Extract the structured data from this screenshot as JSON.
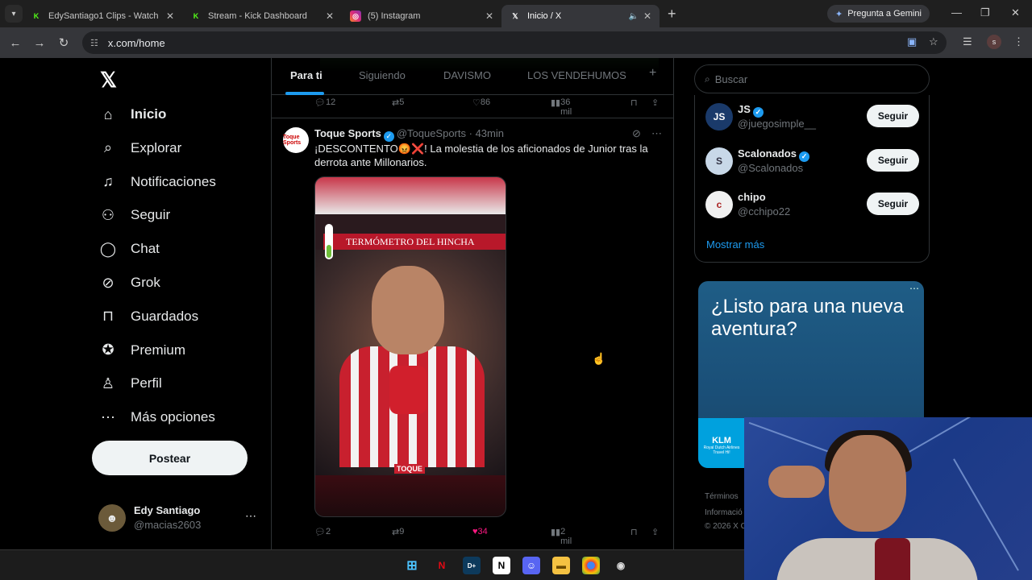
{
  "browser": {
    "tabs": [
      {
        "title": "EdySantiago1 Clips - Watch Live",
        "favicon": "kick-icon"
      },
      {
        "title": "Stream - Kick Dashboard",
        "favicon": "kick-icon"
      },
      {
        "title": "(5) Instagram",
        "favicon": "instagram-icon"
      },
      {
        "title": "Inicio / X",
        "favicon": "x-icon",
        "active": true
      }
    ],
    "gemini_label": "Pregunta a Gemini",
    "url": "x.com/home",
    "profile_initial": "s"
  },
  "sidebar": {
    "items": [
      {
        "label": "Inicio",
        "icon": "home-icon",
        "glyph": "⌂"
      },
      {
        "label": "Explorar",
        "icon": "search-icon",
        "glyph": "⌕"
      },
      {
        "label": "Notificaciones",
        "icon": "bell-icon",
        "glyph": "♫"
      },
      {
        "label": "Seguir",
        "icon": "follow-icon",
        "glyph": "⚇"
      },
      {
        "label": "Chat",
        "icon": "chat-icon",
        "glyph": "◯"
      },
      {
        "label": "Grok",
        "icon": "grok-icon",
        "glyph": "⊘"
      },
      {
        "label": "Guardados",
        "icon": "bookmark-icon",
        "glyph": "⊓"
      },
      {
        "label": "Premium",
        "icon": "premium-icon",
        "glyph": "✪"
      },
      {
        "label": "Perfil",
        "icon": "profile-icon",
        "glyph": "♙"
      },
      {
        "label": "Más opciones",
        "icon": "more-icon",
        "glyph": "⋯"
      }
    ],
    "post_label": "Postear",
    "user": {
      "name": "Edy Santiago",
      "handle": "@macias2603"
    }
  },
  "feed": {
    "tabs": [
      "Para ti",
      "Siguiendo",
      "DAVISMO",
      "LOS VENDEHUMOS"
    ],
    "prev_actions": {
      "replies": "12",
      "reposts": "5",
      "likes": "86",
      "views": "36 mil"
    },
    "tweet": {
      "author": "Toque Sports",
      "handle": "@ToqueSports",
      "time": "· 43min",
      "avatar_text": "Toque Sports",
      "text": "¡DESCONTENTO😡❌! La molestia de los aficionados de Junior tras la derrota ante Millonarios.",
      "media_banner": "TERMÓMETRO DEL HINCHA",
      "media_logo": "TOQUE",
      "replies": "2",
      "reposts": "9",
      "likes": "34",
      "views": "2 mil"
    }
  },
  "right": {
    "search_placeholder": "Buscar",
    "follow": [
      {
        "name": "JS",
        "handle": "@juegosimple__",
        "avatar": "JS",
        "verified": true,
        "button": "Seguir"
      },
      {
        "name": "Scalonados",
        "handle": "@Scalonados",
        "avatar": "S",
        "verified": true,
        "button": "Seguir"
      },
      {
        "name": "chipo",
        "handle": "@cchipo22",
        "avatar": "c",
        "verified": false,
        "button": "Seguir"
      }
    ],
    "show_more": "Mostrar más",
    "ad": {
      "headline": "¿Listo para una nueva aventura?",
      "brand": "KLM",
      "brand_sub": "Royal Dutch Airlines",
      "brand_tag": "Travel Hi!"
    },
    "legal": [
      "Términos",
      "Informació",
      "© 2026 X C"
    ]
  },
  "colors": {
    "accent": "#1d9bf0",
    "like": "#f91880"
  }
}
